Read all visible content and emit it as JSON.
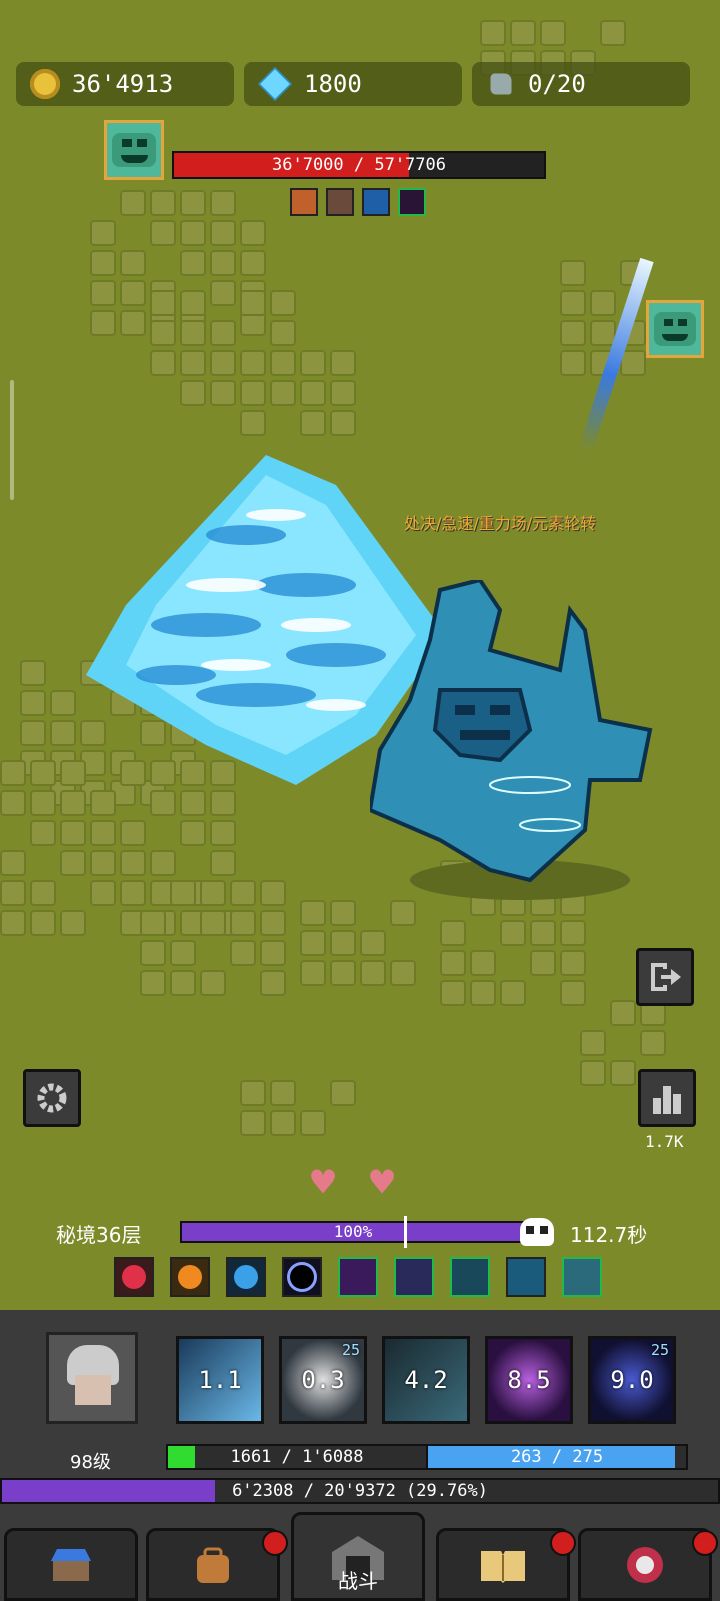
{
  "resources": {
    "gold": "36'4913",
    "gems": "1800",
    "ore": "0/20"
  },
  "boss": {
    "hp_text": "36'7000 / 57'7706",
    "hp_fraction": 0.636,
    "buff_icons": [
      "slash-buff-icon",
      "claw-buff-icon",
      "ice-blade-buff-icon",
      "void-buff-icon"
    ]
  },
  "enemy_affixes": "处决/急速/重力场/元素轮转",
  "stats_button_value": "1.7K",
  "floor_label": "秘境36层",
  "floor_progress": {
    "text": "100%",
    "fraction": 1.0
  },
  "timer": "112.7秒",
  "skills": [
    {
      "cooldown": "1.1",
      "badge": ""
    },
    {
      "cooldown": "0.3",
      "badge": "25"
    },
    {
      "cooldown": "4.2",
      "badge": ""
    },
    {
      "cooldown": "8.5",
      "badge": ""
    },
    {
      "cooldown": "9.0",
      "badge": "25"
    }
  ],
  "player": {
    "level": "98级",
    "hp_text": "1661 / 1'6088",
    "hp_fraction": 0.103,
    "mp_text": "263 / 275",
    "mp_fraction": 0.956,
    "xp_text": "6'2308 / 20'9372 (29.76%)",
    "xp_fraction": 0.2976
  },
  "nav": {
    "battle_label": "战斗"
  },
  "colors": {
    "grass": "#7d8a2a",
    "boss_hp": "#d31e1e",
    "progress": "#7a3fc9",
    "player_hp": "#2fdc2f",
    "player_mp": "#4aa3f0",
    "affix_text": "#f0a830"
  }
}
